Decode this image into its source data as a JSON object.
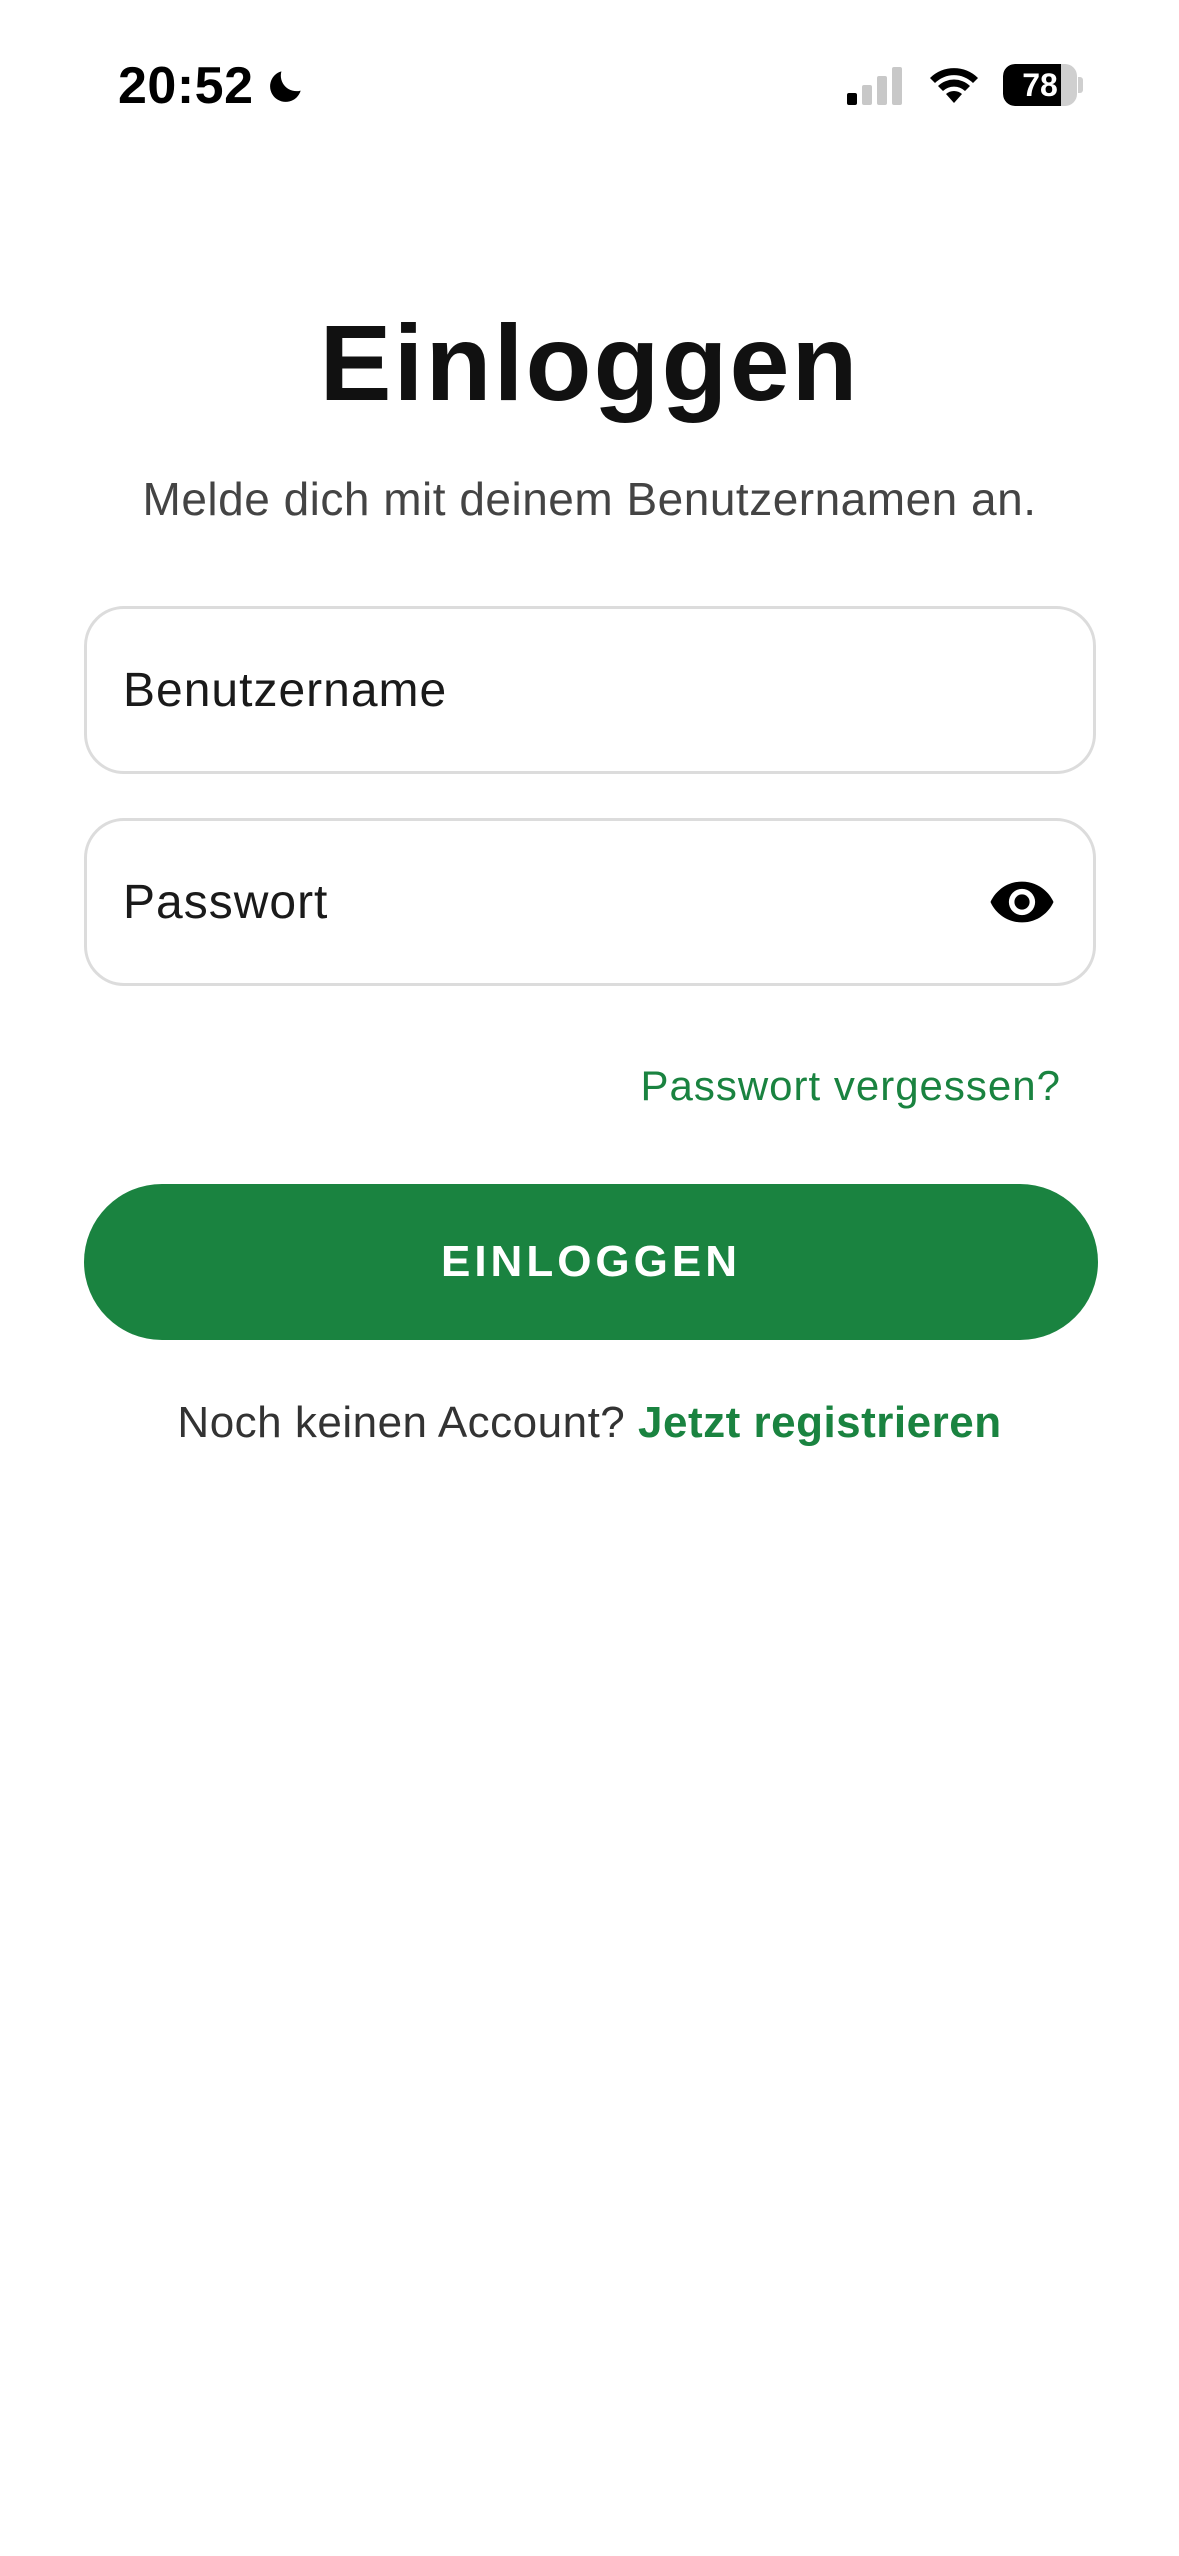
{
  "status_bar": {
    "time": "20:52",
    "battery": "78",
    "battery_level": 0.78,
    "icons": [
      "moon-icon",
      "signal-icon",
      "wifi-icon",
      "battery-icon"
    ]
  },
  "login": {
    "title": "Einloggen",
    "subtitle": "Melde dich mit deinem Benutzernamen an.",
    "username_placeholder": "Benutzername",
    "username_value": "",
    "password_placeholder": "Passwort",
    "password_value": "",
    "forgot_label": "Passwort vergessen?",
    "submit_label": "EINLOGGEN",
    "register_prompt": "Noch keinen Account?",
    "register_link": "Jetzt registrieren"
  },
  "colors": {
    "accent": "#1a8340",
    "field_border": "#dcdcdc",
    "text": "#111111",
    "subtext": "#444444"
  }
}
